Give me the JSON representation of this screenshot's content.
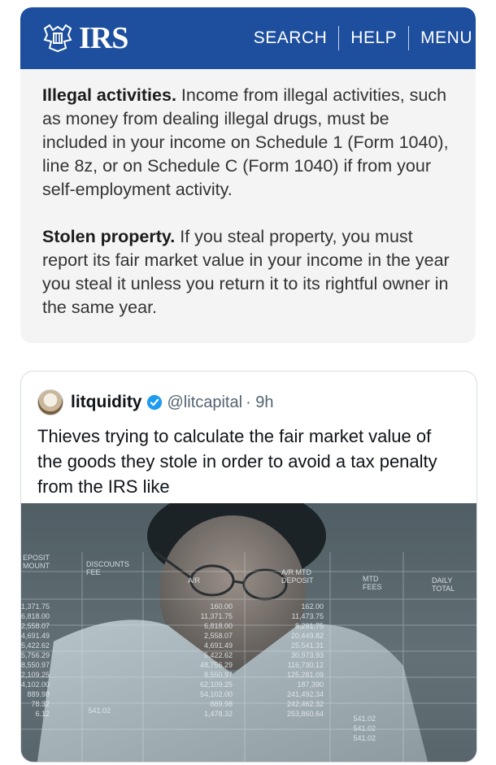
{
  "irs": {
    "logo_text": "IRS",
    "nav": [
      "SEARCH",
      "HELP",
      "MENU"
    ],
    "sections": [
      {
        "heading": "Illegal activities.",
        "body": " Income from illegal activities, such as money from dealing illegal drugs, must be included in your income on Schedule 1 (Form 1040), line 8z, or on Schedule C (Form 1040) if from your self-employment activity."
      },
      {
        "heading": "Stolen property.",
        "body": " If you steal property, you must report its fair market value in your income in the year you steal it unless you return it to its rightful owner in the same year."
      }
    ],
    "colors": {
      "header": "#1d4f9e",
      "background": "#f4f4f4"
    }
  },
  "tweet": {
    "name": "litquidity",
    "handle": "@litcapital",
    "time": "· 9h",
    "text": "Thieves trying to calculate the fair market value of the goods they stole in order to avoid a tax penalty from the IRS like",
    "verified_color": "#1d9bf0",
    "media": {
      "description": "man calculating with spreadsheet overlay",
      "column_headers": [
        "EPOSIT\nMOUNT",
        "DISCOUNTS\nFEE",
        "A/R",
        "A/R MTD\nDEPOSIT",
        "MTD\nFEES",
        "DAILY\nTOTAL"
      ],
      "col_a": [
        "11,371.75",
        "6,818.00",
        "2,558.07",
        "4,691.49",
        "5,422.62",
        "5,756.29",
        "8,550.97",
        "62,109.25",
        "54,102.00",
        "889.98",
        "78.32",
        "6.12"
      ],
      "col_b": [
        "541.02"
      ],
      "col_ar": [
        "160.00",
        "11,371.75",
        "6,818.00",
        "2,558.07",
        "4,691.49",
        "5,422.62",
        "48,756.29",
        "8,550.97",
        "62,109.25",
        "54,102.00",
        "889.98",
        "1,478.32"
      ],
      "col_dep": [
        "162.00",
        "11,473.75",
        "8,291.75",
        "20,449.82",
        "25,541.31",
        "30,973.93",
        "116,730.12",
        "125,281.09",
        "187,390",
        "241,492.34",
        "242,462.32",
        "253,860.64"
      ],
      "col_daily": [
        "541.02",
        "541.02",
        "541.02"
      ]
    }
  }
}
